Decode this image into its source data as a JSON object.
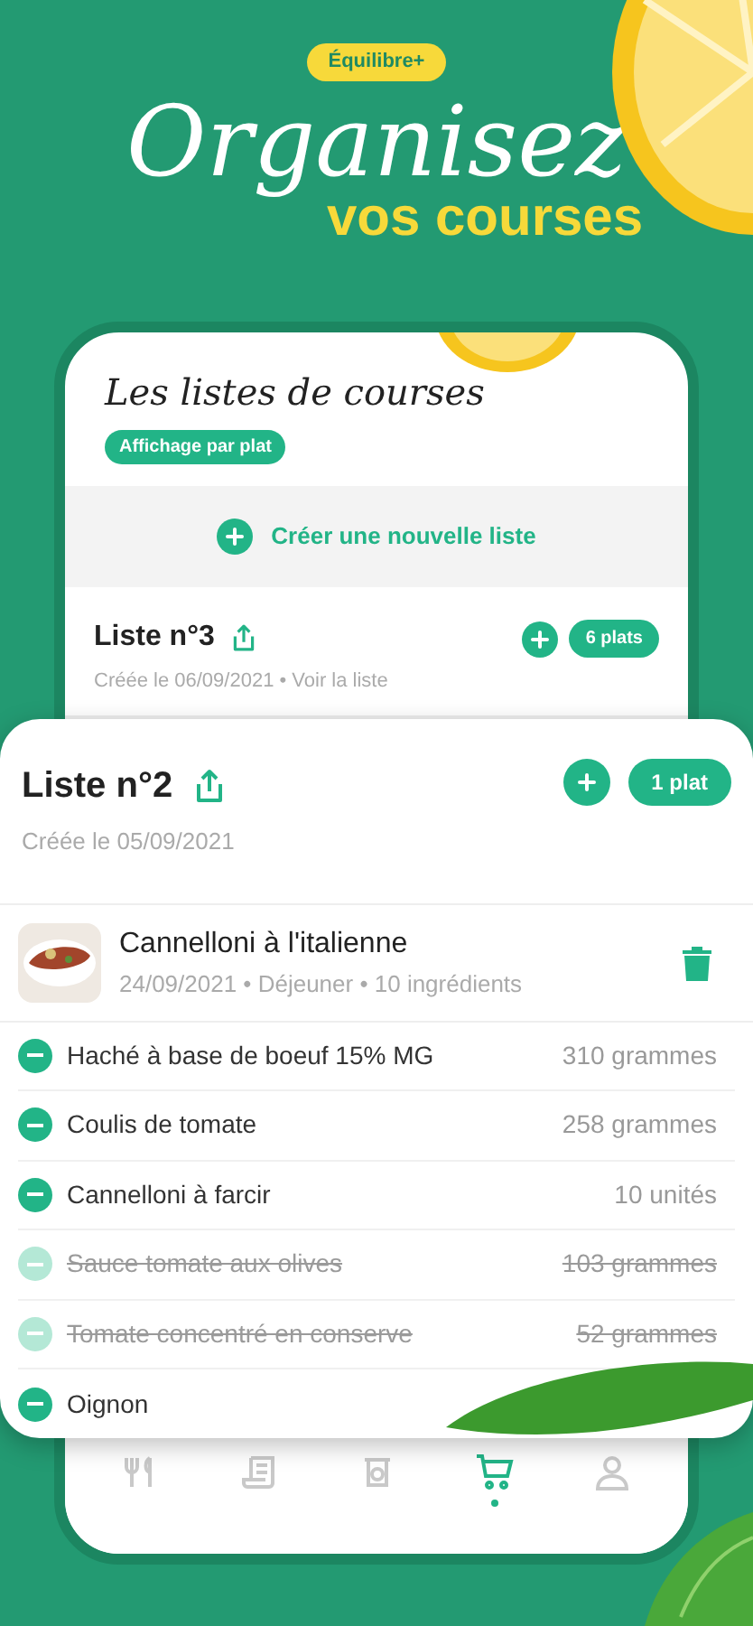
{
  "promo": {
    "badge": "Équilibre+",
    "headline": "Organisez",
    "subheadline": "vos courses"
  },
  "phone": {
    "title": "Les listes de courses",
    "view_toggle": "Affichage par plat",
    "create_list": "Créer une nouvelle liste",
    "lists": [
      {
        "name": "Liste n°3",
        "count": "6 plats",
        "meta": "Créée le 06/09/2021 • Voir la liste"
      }
    ],
    "nav": [
      {
        "kind": "recipes",
        "selected": false
      },
      {
        "kind": "scroll",
        "selected": false
      },
      {
        "kind": "scale",
        "selected": false
      },
      {
        "kind": "cart",
        "selected": true
      },
      {
        "kind": "profile",
        "selected": false
      }
    ]
  },
  "card": {
    "name": "Liste n°2",
    "count": "1 plat",
    "meta": "Créée le 05/09/2021",
    "dish": {
      "name": "Cannelloni à l'italienne",
      "meta": "24/09/2021 • Déjeuner • 10 ingrédients"
    },
    "ingredients": [
      {
        "name": "Haché à base de boeuf 15% MG",
        "quantity": "310 grammes",
        "checked": false
      },
      {
        "name": "Coulis de tomate",
        "quantity": "258 grammes",
        "checked": false
      },
      {
        "name": "Cannelloni à farcir",
        "quantity": "10 unités",
        "checked": false
      },
      {
        "name": "Sauce tomate aux olives",
        "quantity": "103 grammes",
        "checked": true
      },
      {
        "name": "Tomate concentré en conserve",
        "quantity": "52 grammes",
        "checked": true
      },
      {
        "name": "Oignon",
        "checked": false
      }
    ]
  }
}
